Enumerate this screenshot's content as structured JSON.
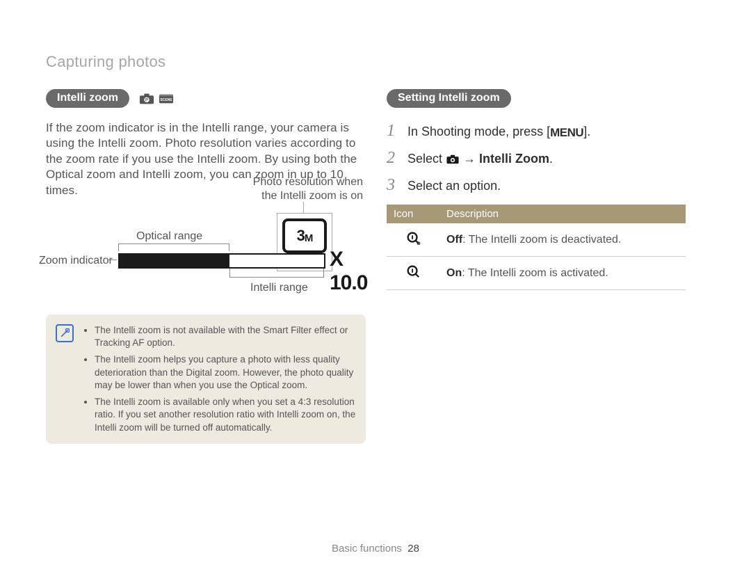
{
  "breadcrumb": "Capturing photos",
  "left": {
    "pill": "Intelli zoom",
    "body": "If the zoom indicator is in the Intelli range, your camera is using the Intelli zoom. Photo resolution varies according to the zoom rate if you use the Intelli zoom. By using both the Optical zoom and Intelli zoom, you can zoom in up to 10 times."
  },
  "diagram": {
    "photo_res_label": "Photo resolution when\nthe Intelli zoom is on",
    "optical_label": "Optical range",
    "zoom_indicator_label": "Zoom indicator",
    "intelli_label": "Intelli range",
    "resolution_badge": "3",
    "resolution_badge_suffix": "M",
    "zoom_multiplier": "X 10.0"
  },
  "notes": [
    "The Intelli zoom is not available with the Smart Filter effect or Tracking AF option.",
    "The Intelli zoom helps you capture a photo with less quality deterioration than the Digital zoom. However, the photo quality may be lower than when you use the Optical zoom.",
    "The Intelli zoom is available only when you set a 4:3 resolution ratio. If you set another resolution ratio with Intelli zoom on, the Intelli zoom will be turned off automatically."
  ],
  "right": {
    "pill": "Setting Intelli zoom",
    "steps": {
      "s1_pre": "In Shooting mode, press [",
      "s1_menu": "MENU",
      "s1_post": "].",
      "s2_pre": "Select ",
      "s2_arrow": " → ",
      "s2_bold": "Intelli Zoom",
      "s2_post": ".",
      "s3": "Select an option."
    }
  },
  "table": {
    "head_icon": "Icon",
    "head_desc": "Description",
    "rows": [
      {
        "bold": "Off",
        "text": ": The Intelli zoom is deactivated."
      },
      {
        "bold": "On",
        "text": ": The Intelli zoom is activated."
      }
    ]
  },
  "footer": {
    "section": "Basic functions",
    "page": "28"
  }
}
